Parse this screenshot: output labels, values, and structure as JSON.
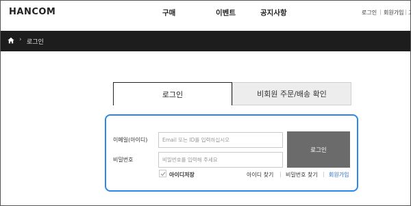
{
  "header": {
    "logo": "HANCOM",
    "nav": [
      {
        "label": "구매"
      },
      {
        "label": "이벤트"
      },
      {
        "label": "공지사항"
      }
    ],
    "util": [
      {
        "label": "로그인"
      },
      {
        "label": "회원가입"
      },
      {
        "label": "고"
      }
    ]
  },
  "breadcrumb": {
    "home_icon": "home-icon",
    "current": "로그인"
  },
  "tabs": [
    {
      "label": "로그인",
      "active": true
    },
    {
      "label": "비회원 주문/배송 확인",
      "active": false
    }
  ],
  "login_form": {
    "email_label": "이메일(아이디)",
    "email_placeholder": "Email 또는 ID를 입력하십시오",
    "password_label": "비밀번호",
    "password_placeholder": "비밀번호를 입력해 주세요",
    "login_button": "로그인",
    "save_id_label": "아이디저장",
    "save_id_checked": true,
    "links": [
      {
        "label": "아이디 찾기"
      },
      {
        "label": "비밀번호 찾기"
      },
      {
        "label": "회원가입"
      }
    ]
  },
  "colors": {
    "accent_border": "#2a87e8",
    "breadcrumb_bg": "#1d1d1d",
    "login_button_bg": "#6b6b6b",
    "signup_link": "#2a6ad0"
  }
}
